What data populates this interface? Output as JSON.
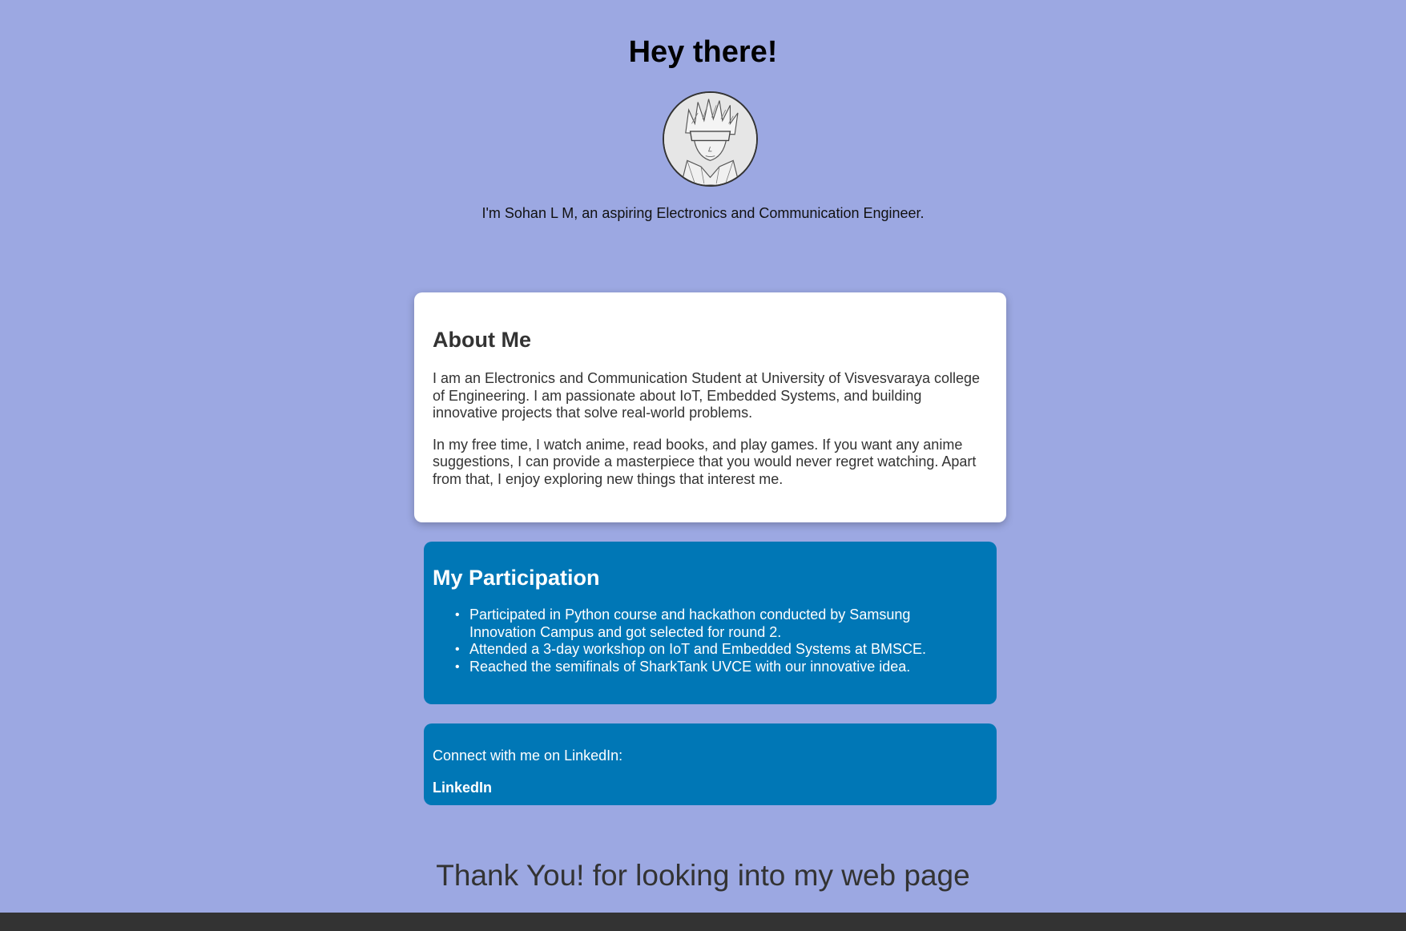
{
  "header": {
    "title": "Hey there!",
    "intro": "I'm Sohan L M, an aspiring Electronics and Communication Engineer."
  },
  "about": {
    "heading": "About Me",
    "paragraphs": [
      "I am an Electronics and Communication Student at University of Visvesvaraya college of Engineering. I am passionate about IoT, Embedded Systems, and building innovative projects that solve real-world problems.",
      "In my free time, I watch anime, read books, and play games. If you want any anime suggestions, I can provide a masterpiece that you would never regret watching. Apart from that, I enjoy exploring new things that interest me."
    ]
  },
  "participation": {
    "heading": "My Participation",
    "items": [
      "Participated in Python course and hackathon conducted by Samsung Innovation Campus and got selected for round 2.",
      "Attended a 3-day workshop on IoT and Embedded Systems at BMSCE.",
      "Reached the semifinals of SharkTank UVCE with our innovative idea."
    ]
  },
  "connect": {
    "text": "Connect with me on LinkedIn:",
    "link_label": "LinkedIn"
  },
  "footer": {
    "thanks": "Thank You! for looking into my web page"
  },
  "colors": {
    "background": "#9ca8e2",
    "card_white": "#ffffff",
    "card_blue": "#0077b6",
    "footer_bar": "#333333"
  },
  "icons": {
    "avatar": "profile-sketch-avatar"
  }
}
